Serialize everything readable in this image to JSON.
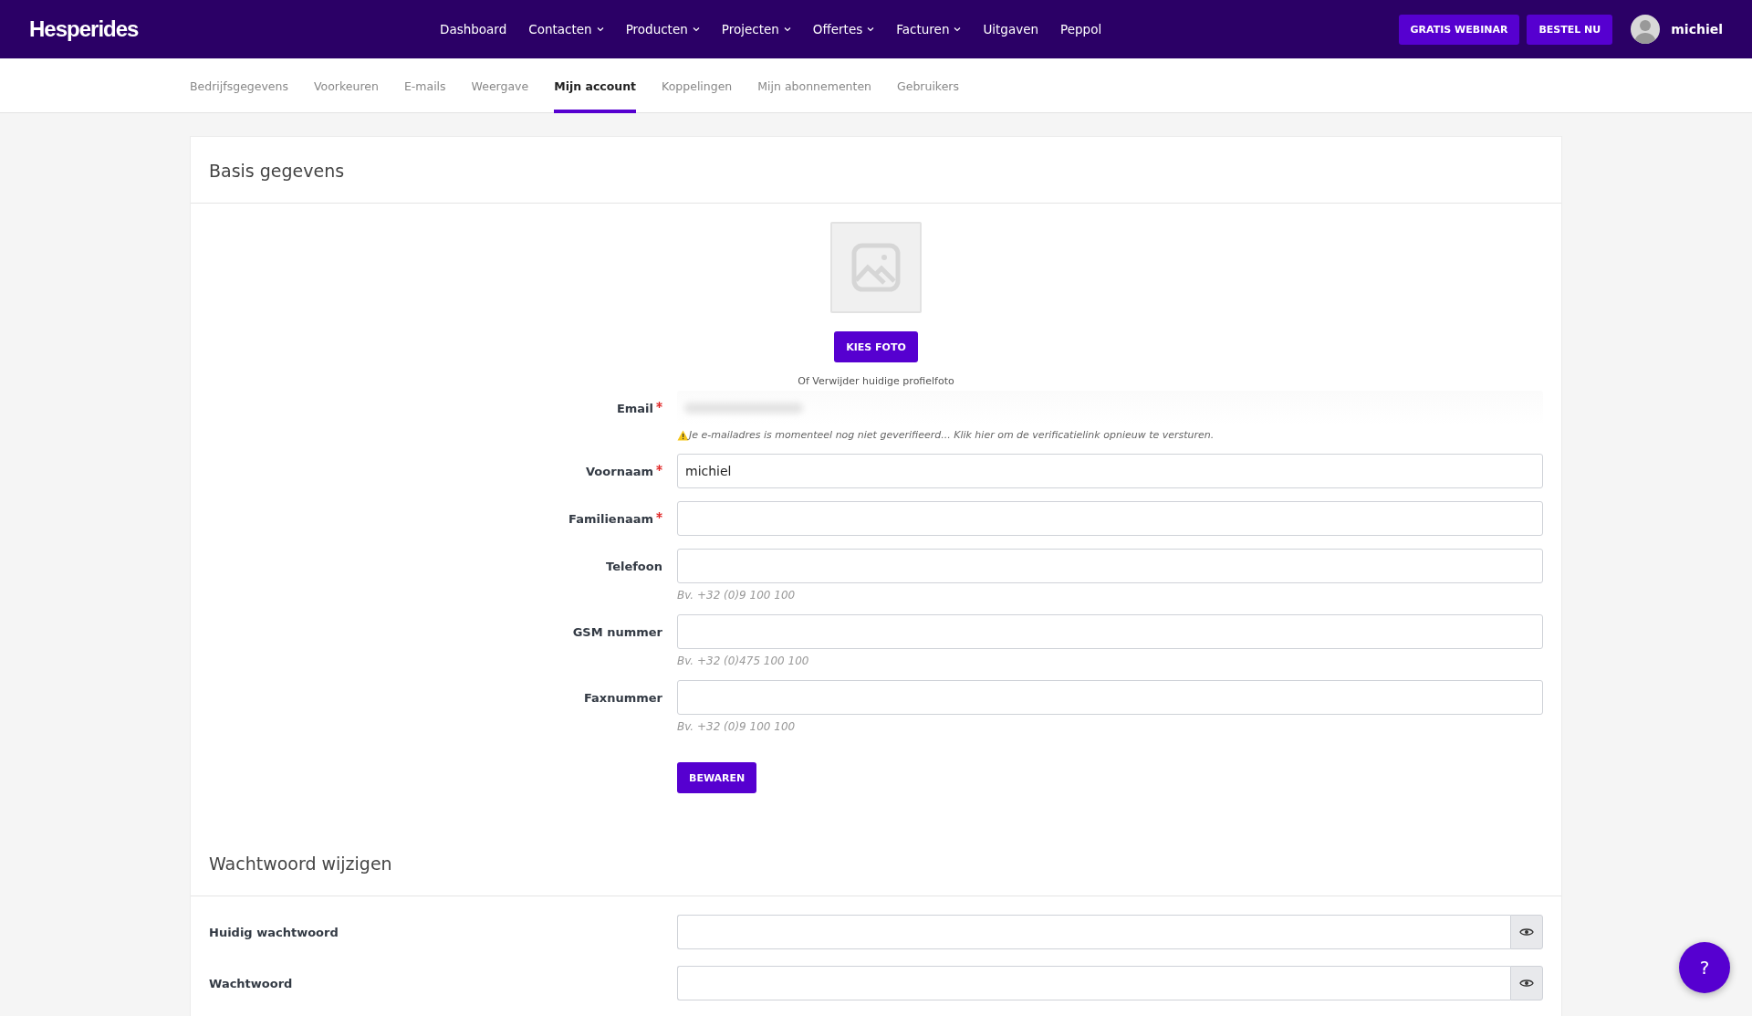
{
  "brand": "Hesperides",
  "nav": [
    {
      "label": "Dashboard",
      "dropdown": false
    },
    {
      "label": "Contacten",
      "dropdown": true
    },
    {
      "label": "Producten",
      "dropdown": true
    },
    {
      "label": "Projecten",
      "dropdown": true
    },
    {
      "label": "Offertes",
      "dropdown": true
    },
    {
      "label": "Facturen",
      "dropdown": true
    },
    {
      "label": "Uitgaven",
      "dropdown": false
    },
    {
      "label": "Peppol",
      "dropdown": false
    }
  ],
  "header_buttons": [
    "GRATIS WEBINAR",
    "BESTEL NU"
  ],
  "user": {
    "name": "michiel"
  },
  "tabs": [
    {
      "label": "Bedrijfsgegevens",
      "selected": false
    },
    {
      "label": "Voorkeuren",
      "selected": false
    },
    {
      "label": "E-mails",
      "selected": false
    },
    {
      "label": "Weergave",
      "selected": false
    },
    {
      "label": "Mijn account",
      "selected": true
    },
    {
      "label": "Koppelingen",
      "selected": false
    },
    {
      "label": "Mijn abonnementen",
      "selected": false
    },
    {
      "label": "Gebruikers",
      "selected": false
    }
  ],
  "basis": {
    "title": "Basis gegevens",
    "photo_button": "KIES FOTO",
    "photo_note": "Of Verwijder huidige profielfoto",
    "fields": [
      {
        "kind": "redacted",
        "label": "Email",
        "required": true,
        "warning": "Je e-mailadres is momenteel nog niet geverifieerd... Klik hier om de verificatielink opnieuw te versturen."
      },
      {
        "kind": "text",
        "label": "Voornaam",
        "required": true,
        "value": "michiel"
      },
      {
        "kind": "text",
        "label": "Familienaam",
        "required": true
      },
      {
        "kind": "text",
        "label": "Telefoon",
        "required": false,
        "hint": "Bv. +32 (0)9 100 100"
      },
      {
        "kind": "text",
        "label": "GSM nummer",
        "required": false,
        "hint": "Bv. +32 (0)475 100 100"
      },
      {
        "kind": "text",
        "label": "Faxnummer",
        "required": false,
        "hint": "Bv. +32 (0)9 100 100"
      }
    ],
    "save_button": "BEWAREN"
  },
  "password": {
    "title": "Wachtwoord wijzigen",
    "fields": [
      {
        "label": "Huidig wachtwoord"
      },
      {
        "label": "Wachtwoord"
      }
    ]
  },
  "help_button": "?"
}
